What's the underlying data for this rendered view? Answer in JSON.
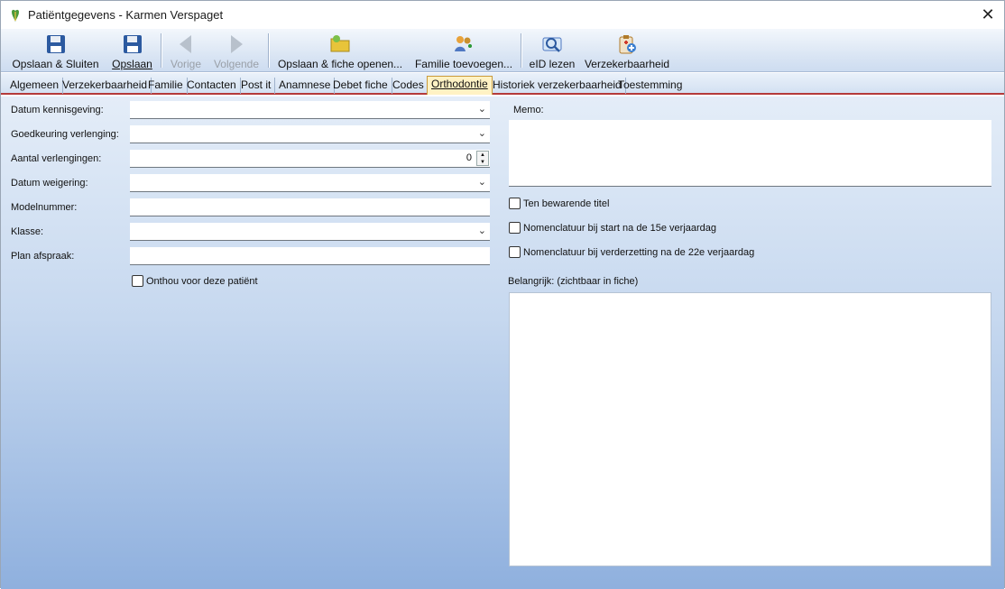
{
  "window": {
    "title": "Patiëntgegevens - Karmen Verspaget"
  },
  "toolbar": {
    "save_close": "Opslaan & Sluiten",
    "save": "Opslaan",
    "prev": "Vorige",
    "next": "Volgende",
    "save_open": "Opslaan & fiche openen...",
    "add_family": "Familie toevoegen...",
    "eid": "eID lezen",
    "insurance": "Verzekerbaarheid"
  },
  "tabs": [
    "Algemeen",
    "Verzekerbaarheid",
    "Familie",
    "Contacten",
    "Post it",
    "Anamnese",
    "Debet fiche",
    "Codes",
    "Orthodontie",
    "Historiek verzekerbaarheid",
    "Toestemming"
  ],
  "active_tab": "Orthodontie",
  "form": {
    "datum_kennisgeving": "Datum kennisgeving:",
    "goedkeuring_verlenging": "Goedkeuring verlenging:",
    "aantal_verlengingen": "Aantal verlengingen:",
    "aantal_verlengingen_value": "0",
    "datum_weigering": "Datum weigering:",
    "modelnummer": "Modelnummer:",
    "klasse": "Klasse:",
    "plan_afspraak": "Plan afspraak:",
    "onthou": "Onthou voor deze patiënt"
  },
  "right": {
    "memo": "Memo:",
    "ten_bewarende_titel": "Ten bewarende titel",
    "nomen_15": "Nomenclatuur bij start na de 15e verjaardag",
    "nomen_22": "Nomenclatuur bij verderzetting na de 22e verjaardag",
    "belangrijk": "Belangrijk: (zichtbaar in fiche)"
  }
}
